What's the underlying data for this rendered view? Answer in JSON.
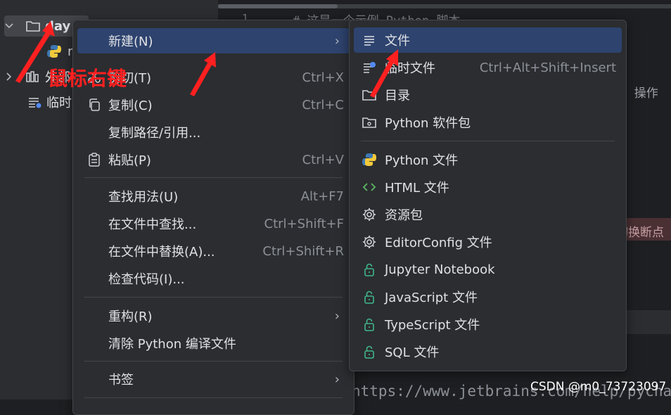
{
  "colors": {
    "accent": "#2e436e",
    "annotation": "#ff2020",
    "python_blue": "#3d78b4",
    "python_yellow": "#f1c93b",
    "html_green": "#5fb865",
    "lock_green": "#3fb68b"
  },
  "tree": {
    "rows": [
      {
        "label": "day",
        "icon": "folder-icon"
      },
      {
        "label": "n",
        "icon": "python-icon"
      },
      {
        "label": "外部",
        "icon": "library-icon"
      },
      {
        "label": "临时",
        "icon": "scratch-icon"
      }
    ]
  },
  "editor": {
    "line_number": "1",
    "code_line": "# 这是一个示例 Python 脚本。",
    "side_text_1": "l、操作",
    "side_text_2": "切换断点",
    "url": "https://www.jetbrains.com/help/pycharm/"
  },
  "watermark": "CSDN @m0_73723097",
  "annotation": {
    "text": "鼠标右键"
  },
  "context_menu": {
    "items": [
      {
        "label": "新建(N)",
        "mnemonic": "N",
        "shortcut": "",
        "submenu": true,
        "icon": ""
      },
      {
        "label": "剪切(T)",
        "mnemonic": "T",
        "shortcut": "Ctrl+X",
        "icon": "cut-icon"
      },
      {
        "label": "复制(C)",
        "mnemonic": "C",
        "shortcut": "Ctrl+C",
        "icon": "copy-icon"
      },
      {
        "label": "复制路径/引用...",
        "shortcut": "",
        "icon": ""
      },
      {
        "label": "粘贴(P)",
        "mnemonic": "P",
        "shortcut": "Ctrl+V",
        "icon": "paste-icon"
      },
      {
        "label": "查找用法(U)",
        "mnemonic": "U",
        "shortcut": "Alt+F7",
        "icon": ""
      },
      {
        "label": "在文件中查找...",
        "shortcut": "Ctrl+Shift+F",
        "icon": ""
      },
      {
        "label": "在文件中替换(A)...",
        "mnemonic": "A",
        "shortcut": "Ctrl+Shift+R",
        "icon": ""
      },
      {
        "label": "检查代码(I)...",
        "mnemonic": "I",
        "shortcut": "",
        "icon": ""
      },
      {
        "label": "重构(R)",
        "mnemonic": "R",
        "shortcut": "",
        "submenu": true,
        "icon": ""
      },
      {
        "label": "清除 Python 编译文件",
        "shortcut": "",
        "icon": ""
      },
      {
        "label": "书签",
        "shortcut": "",
        "submenu": true,
        "icon": ""
      }
    ]
  },
  "new_submenu": {
    "items": [
      {
        "label": "文件",
        "shortcut": "",
        "icon": "file-lines-icon"
      },
      {
        "label": "临时文件",
        "shortcut": "Ctrl+Alt+Shift+Insert",
        "icon": "scratch-file-icon"
      },
      {
        "label": "目录",
        "shortcut": "",
        "icon": "folder-icon"
      },
      {
        "label": "Python 软件包",
        "shortcut": "",
        "icon": "package-folder-icon"
      },
      {
        "label": "Python 文件",
        "shortcut": "",
        "icon": "python-icon"
      },
      {
        "label": "HTML 文件",
        "shortcut": "",
        "icon": "html-icon"
      },
      {
        "label": "资源包",
        "shortcut": "",
        "icon": "gear-icon"
      },
      {
        "label": "EditorConfig 文件",
        "shortcut": "",
        "icon": "gear-icon"
      },
      {
        "label": "Jupyter Notebook",
        "shortcut": "",
        "icon": "lock-icon"
      },
      {
        "label": "JavaScript 文件",
        "shortcut": "",
        "icon": "lock-icon"
      },
      {
        "label": "TypeScript 文件",
        "shortcut": "",
        "icon": "lock-icon"
      },
      {
        "label": "SQL 文件",
        "shortcut": "",
        "icon": "lock-icon"
      }
    ]
  }
}
